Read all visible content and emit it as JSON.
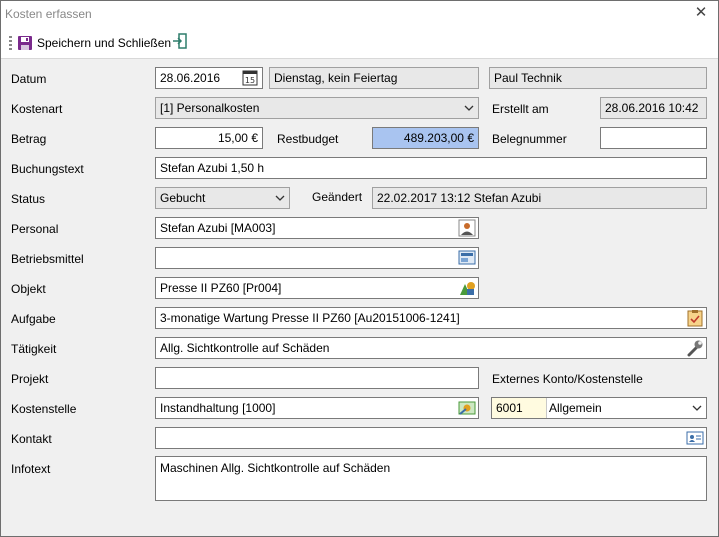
{
  "window": {
    "title": "Kosten erfassen",
    "close_label": "✕"
  },
  "toolbar": {
    "save_close_label": "Speichern und Schließen"
  },
  "labels": {
    "datum": "Datum",
    "kostenart": "Kostenart",
    "erstellt_am": "Erstellt am",
    "betrag": "Betrag",
    "restbudget": "Restbudget",
    "belegnummer": "Belegnummer",
    "buchungstext": "Buchungstext",
    "status": "Status",
    "geaendert": "Geändert",
    "personal": "Personal",
    "betriebsmittel": "Betriebsmittel",
    "objekt": "Objekt",
    "aufgabe": "Aufgabe",
    "taetigkeit": "Tätigkeit",
    "projekt": "Projekt",
    "externes_konto": "Externes Konto/Kostenstelle",
    "kostenstelle": "Kostenstelle",
    "kontakt": "Kontakt",
    "infotext": "Infotext"
  },
  "values": {
    "datum": "28.06.2016",
    "datum_info": "Dienstag, kein Feiertag",
    "user": "Paul Technik",
    "kostenart": "[1] Personalkosten",
    "erstellt_am": "28.06.2016 10:42",
    "betrag": "15,00 €",
    "restbudget": "489.203,00 €",
    "belegnummer": "",
    "buchungstext": "Stefan Azubi 1,50 h",
    "status": "Gebucht",
    "geaendert": "22.02.2017 13:12 Stefan Azubi",
    "personal": "Stefan Azubi [MA003]",
    "betriebsmittel": "",
    "objekt": "Presse II PZ60 [Pr004]",
    "aufgabe": "3-monatige Wartung Presse II PZ60 [Au20151006-1241]",
    "taetigkeit": "Allg. Sichtkontrolle auf Schäden",
    "projekt": "",
    "externes_konto_nr": "6001",
    "externes_konto_name": "Allgemein",
    "kostenstelle": "Instandhaltung [1000]",
    "kontakt": "",
    "infotext": "Maschinen Allg. Sichtkontrolle auf Schäden"
  },
  "colors": {
    "restbudget_bg": "#a9c4f0",
    "konto_bg": "#fffbe0"
  },
  "icons": {
    "save": "save-icon",
    "exit": "exit-icon",
    "calendar": "calendar-icon",
    "person": "person-icon",
    "equipment": "equipment-icon",
    "object": "object-icon",
    "task": "clipboard-icon",
    "wrench": "wrench-icon",
    "cost_center": "cost-center-icon",
    "contact": "contact-card-icon"
  }
}
